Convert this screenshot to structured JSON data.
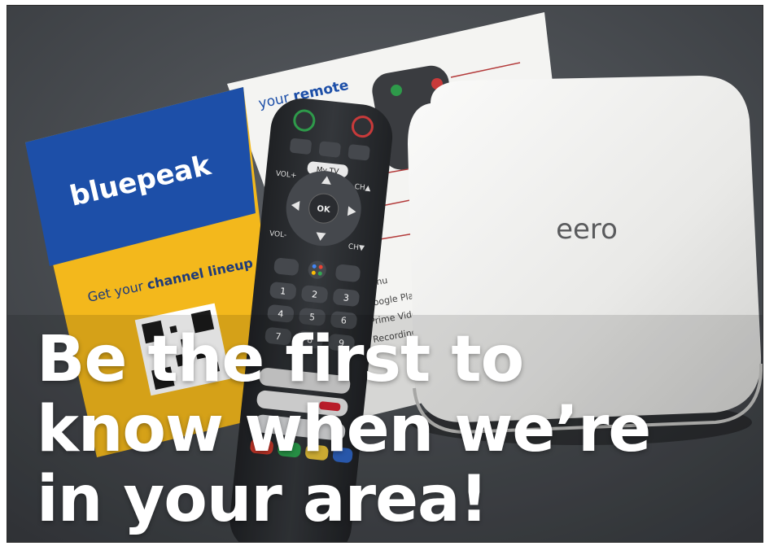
{
  "image": {
    "brand_card": {
      "logo_text": "bluepeak",
      "tagline_prefix": "Get your ",
      "tagline_highlight": "channel lineup",
      "remote_heading_prefix": "your ",
      "remote_heading_highlight": "remote",
      "guide_labels": [
        "Menu",
        "Google Play",
        "Prime Video",
        "Recordings"
      ]
    },
    "remote": {
      "mytv_label": "My TV",
      "ok_label": "OK",
      "vol_up_label": "VOL+",
      "vol_down_label": "VOL-",
      "ch_up_label": "CH▲",
      "ch_down_label": "CH▼",
      "number_keys": [
        "1",
        "2",
        "3",
        "4",
        "5",
        "6",
        "7",
        "8",
        "9"
      ]
    },
    "router": {
      "brand_text": "eero"
    },
    "headline": {
      "line1": "Be the first to",
      "line2": "know when we’re",
      "line3": "in your area!"
    },
    "colors": {
      "bluepeak_blue": "#1d4fa8",
      "bluepeak_yellow": "#f3b81c",
      "surface_gray": "#4a4d52",
      "router_white": "#eeeeec",
      "remote_black": "#2a2c30"
    }
  }
}
